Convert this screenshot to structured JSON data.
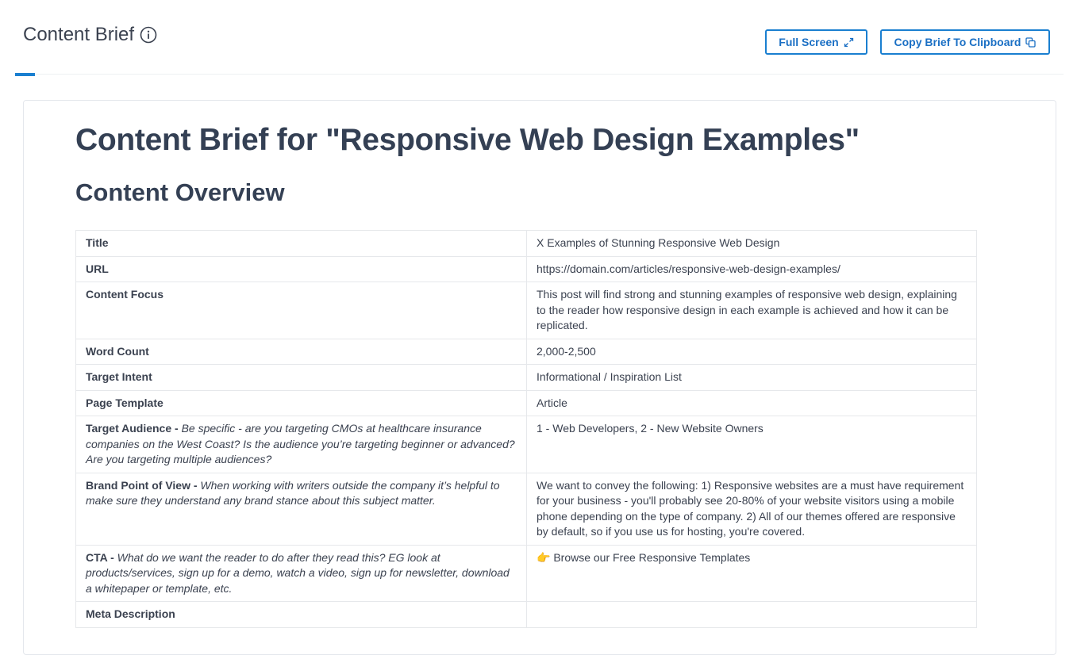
{
  "header": {
    "title": "Content Brief",
    "full_screen_label": "Full Screen",
    "copy_label": "Copy Brief To Clipboard"
  },
  "brief": {
    "heading": "Content Brief for \"Responsive Web Design Examples\"",
    "section_heading": "Content Overview",
    "rows": [
      {
        "key": "Title",
        "note": "",
        "value": "X Examples of Stunning Responsive Web Design"
      },
      {
        "key": "URL",
        "note": "",
        "value": "https://domain.com/articles/responsive-web-design-examples/"
      },
      {
        "key": "Content Focus",
        "note": "",
        "value": "This post will find strong and stunning examples of responsive web design, explaining to the reader how responsive design in each example is achieved and how it can be replicated."
      },
      {
        "key": "Word Count",
        "note": "",
        "value": "2,000-2,500"
      },
      {
        "key": "Target Intent",
        "note": "",
        "value": "Informational / Inspiration List"
      },
      {
        "key": "Page Template",
        "note": "",
        "value": "Article"
      },
      {
        "key": "Target Audience - ",
        "note": "Be specific - are you targeting CMOs at healthcare insurance companies on the West Coast? Is the audience you’re targeting beginner or advanced? Are you targeting multiple audiences?",
        "value": "1 - Web Developers, 2 - New Website Owners"
      },
      {
        "key": "Brand Point of View - ",
        "note": "When working with writers outside the company it’s helpful to make sure they understand any brand stance about this subject matter.",
        "value": "We want to convey the following: 1) Responsive websites are a must have requirement for your business - you'll probably see 20-80% of your website visitors using a mobile phone depending on the type of company. 2) All of our themes offered are responsive by default, so if you use us for hosting, you're covered."
      },
      {
        "key": "CTA - ",
        "note": "What do we want the reader to do after they read this? EG look at products/services, sign up for a demo, watch a video, sign up for newsletter, download a whitepaper or template, etc.",
        "value": "👉 Browse our Free Responsive Templates"
      },
      {
        "key": "Meta Description",
        "note": "",
        "value": ""
      }
    ]
  }
}
